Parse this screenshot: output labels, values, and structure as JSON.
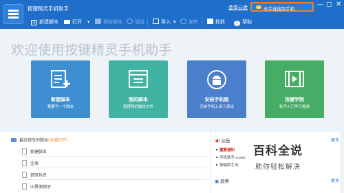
{
  "app": {
    "title": "按键精灵手机助手"
  },
  "header": {
    "server_link": "蓝奏云盘",
    "connect_label": "未手连接到手机",
    "window_controls": {
      "minimize": "—",
      "maximize": "▢",
      "close": "✕"
    }
  },
  "toolbar": {
    "new_script": "新建脚本",
    "open": "打开",
    "save_script": "保存脚本",
    "debug": "调试",
    "import": "导入",
    "publish": "发布",
    "capture": "抓抓",
    "help": "帮助"
  },
  "hero": {
    "title": "欢迎使用按键精灵手机助手",
    "cards": [
      {
        "title": "新建脚本",
        "subtitle": "我要写一个脚本",
        "color": "#3e8fd2"
      },
      {
        "title": "我的脚本",
        "subtitle": "管理我的脚本文件",
        "color": "#41b3a2"
      },
      {
        "title": "安装手机版",
        "subtitle": "安装手机上用于调试",
        "color": "#4a7fcc"
      },
      {
        "title": "按键学院",
        "subtitle": "新手入门学习视频",
        "color": "#47ad66"
      }
    ]
  },
  "recent": {
    "header": "最近修改的脚本",
    "open_all": "(全部打开)",
    "items": [
      "新建脚本",
      "注册",
      "获取包名",
      "UI界面例子"
    ]
  },
  "notice": {
    "title": "公告",
    "more": "更多",
    "items": [
      "重要通知",
      "手机助手-uooo",
      "按键助手无"
    ]
  },
  "trend": {
    "title": "趋势",
    "more": "更多"
  },
  "watermark": {
    "line1": "百科全说",
    "line2": "助你轻松解决"
  },
  "colors": {
    "header_bg": "#1f6ec9",
    "accent_orange": "#f07f2a",
    "hero_bg": "#eef3f8"
  }
}
